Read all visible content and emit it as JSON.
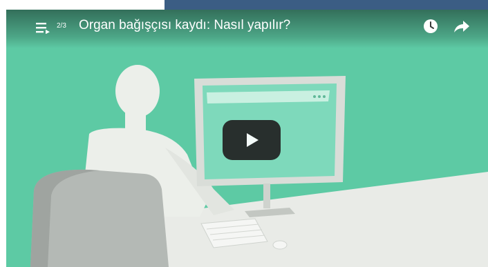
{
  "player": {
    "playlist_index": "2/3",
    "title": "Organ bağışçısı kaydı: Nasıl yapılır?"
  },
  "icons": {
    "playlist": "playlist-icon",
    "watch_later": "clock-icon",
    "share": "share-arrow-icon",
    "play": "play-icon"
  },
  "colors": {
    "scene_background": "#5dcaa4",
    "page_strip": "#3b5d84",
    "play_button": "#212121"
  }
}
